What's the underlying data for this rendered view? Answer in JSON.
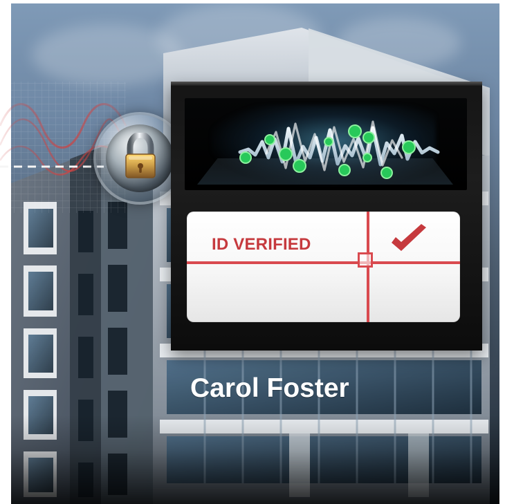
{
  "card": {
    "status": "ID VERIFIED",
    "name": "Carol Foster"
  },
  "icons": {
    "lock": "padlock-icon",
    "check": "checkmark-icon",
    "crosshair": "crosshair-icon",
    "waveform": "waveform-icon"
  },
  "colors": {
    "accent_red": "#c63a3e",
    "crosshair_red": "#d94a4f",
    "wave_green": "#2fd061",
    "frame_black": "#111111"
  }
}
